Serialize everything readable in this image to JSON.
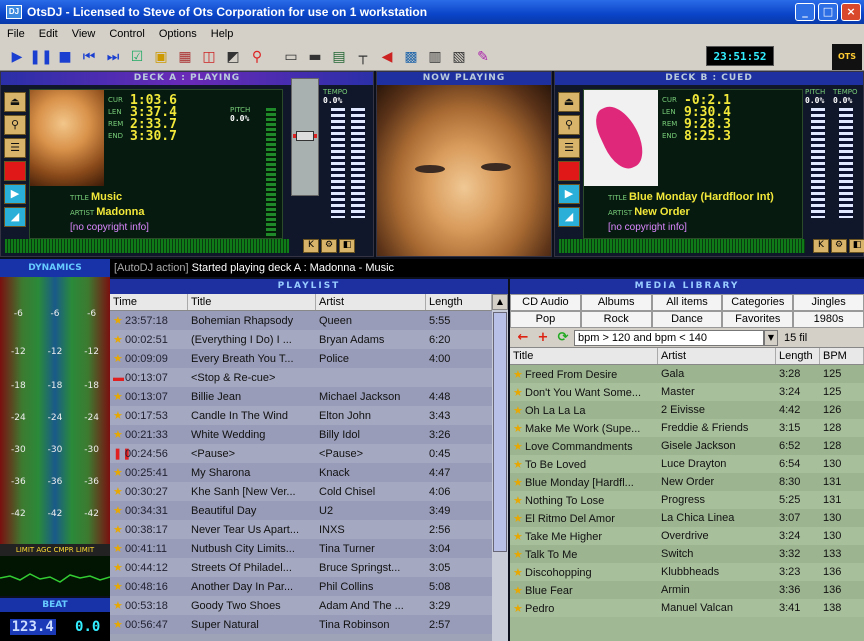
{
  "window": {
    "title": "OtsDJ - Licensed to Steve of Ots Corporation for use on 1 workstation",
    "icon_text": "DJ"
  },
  "menu": [
    "File",
    "Edit",
    "View",
    "Control",
    "Options",
    "Help"
  ],
  "toolbar": {
    "icons": [
      "play-icon",
      "pause-icon",
      "stop-icon",
      "previous-icon",
      "next-icon",
      "checklist-icon",
      "folder-icon",
      "schedule-icon",
      "cart-icon",
      "graph-icon",
      "search-icon",
      "keyboard-icon",
      "keyboard-alt-icon",
      "record-icon",
      "cable-icon",
      "speaker-icon",
      "grid-icon",
      "clipboard-icon",
      "notes-icon",
      "pencil-icon"
    ],
    "clock": "23:51:52",
    "logo": "OTS"
  },
  "deck_a": {
    "header": "DECK A : PLAYING",
    "readouts": [
      {
        "label": "CUR",
        "value": "1:03.6"
      },
      {
        "label": "LEN",
        "value": "3:37.4"
      },
      {
        "label": "REM",
        "value": "2:33.7"
      },
      {
        "label": "END",
        "value": "3:30.7"
      }
    ],
    "pitch_label": "PITCH",
    "tempo_label": "TEMPO",
    "pitch": "0.0%",
    "tempo": "0.0%",
    "title_label": "TITLE",
    "title": "Music",
    "artist_label": "ARTIST",
    "artist": "Madonna",
    "copyright": "[no copyright info]"
  },
  "now_playing": {
    "header": "NOW PLAYING"
  },
  "deck_b": {
    "header": "DECK B : CUED",
    "readouts": [
      {
        "label": "CUR",
        "value": "-0:2.1"
      },
      {
        "label": "LEN",
        "value": "9:30.4"
      },
      {
        "label": "REM",
        "value": "9:28.3"
      },
      {
        "label": "END",
        "value": "8:25.3"
      }
    ],
    "pitch_label": "PITCH",
    "tempo_label": "TEMPO",
    "pitch": "0.0%",
    "tempo": "0.0%",
    "title_label": "TITLE",
    "title": "Blue Monday (Hardfloor Int)",
    "artist_label": "ARTIST",
    "artist": "New Order",
    "copyright": "[no copyright info]"
  },
  "status": {
    "prefix": "[AutoDJ action]",
    "message": "Started playing deck A : Madonna - Music"
  },
  "dynamics": {
    "header": "DYNAMICS",
    "rows": [
      [
        "-6",
        "-6",
        "-6"
      ],
      [
        "-12",
        "-12",
        "-12"
      ],
      [
        "-18",
        "-18",
        "-18"
      ],
      [
        "-24",
        "-24",
        "-24"
      ],
      [
        "-30",
        "-30",
        "-30"
      ],
      [
        "-36",
        "-36",
        "-36"
      ],
      [
        "-42",
        "-42",
        "-42"
      ]
    ],
    "scale_label": "LIMIT AGC CMPR LIMIT"
  },
  "beat": {
    "header": "BEAT",
    "a": "123.4",
    "b": "0.0"
  },
  "playlist": {
    "header": "PLAYLIST",
    "columns": [
      "Time",
      "Title",
      "Artist",
      "Length"
    ],
    "rows": [
      {
        "icon": "star",
        "time": "23:57:18",
        "title": "Bohemian Rhapsody",
        "artist": "Queen",
        "length": "5:55"
      },
      {
        "icon": "star",
        "time": "00:02:51",
        "title": "(Everything I Do) I ...",
        "artist": "Bryan Adams",
        "length": "6:20"
      },
      {
        "icon": "star",
        "time": "00:09:09",
        "title": "Every Breath You T...",
        "artist": "Police",
        "length": "4:00"
      },
      {
        "icon": "stop",
        "time": "00:13:07",
        "title": "<Stop & Re-cue>",
        "artist": "",
        "length": ""
      },
      {
        "icon": "star",
        "time": "00:13:07",
        "title": "Billie Jean",
        "artist": "Michael Jackson",
        "length": "4:48"
      },
      {
        "icon": "star",
        "time": "00:17:53",
        "title": "Candle In The Wind",
        "artist": "Elton John",
        "length": "3:43"
      },
      {
        "icon": "star",
        "time": "00:21:33",
        "title": "White Wedding",
        "artist": "Billy Idol",
        "length": "3:26"
      },
      {
        "icon": "pause",
        "time": "00:24:56",
        "title": "<Pause>",
        "artist": "<Pause>",
        "length": "0:45"
      },
      {
        "icon": "star",
        "time": "00:25:41",
        "title": "My Sharona",
        "artist": "Knack",
        "length": "4:47"
      },
      {
        "icon": "star",
        "time": "00:30:27",
        "title": "Khe Sanh [New Ver...",
        "artist": "Cold Chisel",
        "length": "4:06"
      },
      {
        "icon": "star",
        "time": "00:34:31",
        "title": "Beautiful Day",
        "artist": "U2",
        "length": "3:49"
      },
      {
        "icon": "star",
        "time": "00:38:17",
        "title": "Never Tear Us Apart...",
        "artist": "INXS",
        "length": "2:56"
      },
      {
        "icon": "star",
        "time": "00:41:11",
        "title": "Nutbush City Limits...",
        "artist": "Tina Turner",
        "length": "3:04"
      },
      {
        "icon": "star",
        "time": "00:44:12",
        "title": "Streets Of Philadel...",
        "artist": "Bruce Springst...",
        "length": "3:05"
      },
      {
        "icon": "star",
        "time": "00:48:16",
        "title": "Another Day In Par...",
        "artist": "Phil Collins",
        "length": "5:08"
      },
      {
        "icon": "star",
        "time": "00:53:18",
        "title": "Goody Two Shoes",
        "artist": "Adam And The ...",
        "length": "3:29"
      },
      {
        "icon": "star",
        "time": "00:56:47",
        "title": "Super Natural",
        "artist": "Tina Robinson",
        "length": "2:57"
      }
    ]
  },
  "media_library": {
    "header": "MEDIA LIBRARY",
    "categories": [
      "CD Audio",
      "Albums",
      "All items",
      "Categories",
      "Jingles",
      "Pop",
      "Rock",
      "Dance",
      "Favorites",
      "1980s"
    ],
    "filter": "bpm > 120 and bpm < 140",
    "count": "15 fil",
    "columns": [
      "Title",
      "Artist",
      "Length",
      "BPM"
    ],
    "rows": [
      {
        "title": "Freed From Desire",
        "artist": "Gala",
        "length": "3:28",
        "bpm": "125"
      },
      {
        "title": "Don't You Want Some...",
        "artist": "Master",
        "length": "3:24",
        "bpm": "125"
      },
      {
        "title": "Oh La La La",
        "artist": "2 Eivisse",
        "length": "4:42",
        "bpm": "126"
      },
      {
        "title": "Make Me Work (Supe...",
        "artist": "Freddie & Friends",
        "length": "3:15",
        "bpm": "128"
      },
      {
        "title": "Love Commandments",
        "artist": "Gisele Jackson",
        "length": "6:52",
        "bpm": "128"
      },
      {
        "title": "To Be Loved",
        "artist": "Luce Drayton",
        "length": "6:54",
        "bpm": "130"
      },
      {
        "title": "Blue Monday [Hardfl...",
        "artist": "New Order",
        "length": "8:30",
        "bpm": "131"
      },
      {
        "title": "Nothing To Lose",
        "artist": "Progress",
        "length": "5:25",
        "bpm": "131"
      },
      {
        "title": "El Ritmo Del Amor",
        "artist": "La Chica Linea",
        "length": "3:07",
        "bpm": "130"
      },
      {
        "title": "Take Me Higher",
        "artist": "Overdrive",
        "length": "3:24",
        "bpm": "130"
      },
      {
        "title": "Talk To Me",
        "artist": "Switch",
        "length": "3:32",
        "bpm": "133"
      },
      {
        "title": "Discohopping",
        "artist": "Klubbheads",
        "length": "3:23",
        "bpm": "136"
      },
      {
        "title": "Blue Fear",
        "artist": "Armin",
        "length": "3:36",
        "bpm": "136"
      },
      {
        "title": "Pedro",
        "artist": "Manuel Valcan",
        "length": "3:41",
        "bpm": "138"
      }
    ]
  }
}
